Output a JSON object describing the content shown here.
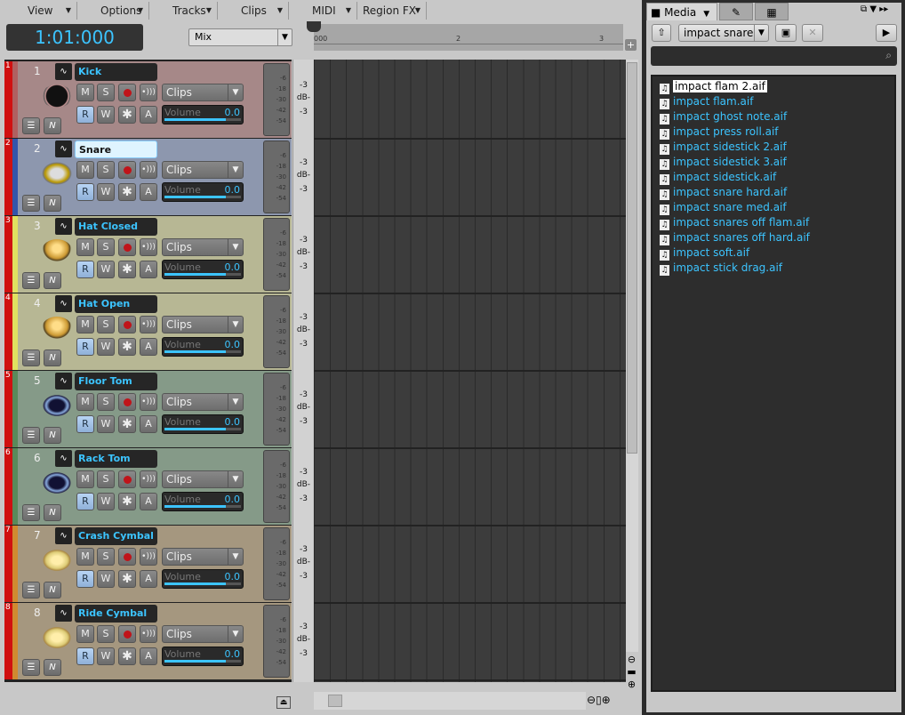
{
  "menu": [
    {
      "label": "View"
    },
    {
      "label": "Options"
    },
    {
      "label": "Tracks"
    },
    {
      "label": "Clips"
    },
    {
      "label": "MIDI"
    },
    {
      "label": "Region FX"
    }
  ],
  "transport": {
    "time": "1:01:000",
    "view_select": "Mix"
  },
  "ruler": {
    "labels": [
      "000",
      "2",
      "3"
    ]
  },
  "track_common": {
    "mute": "M",
    "solo": "S",
    "read": "R",
    "write": "W",
    "fx": "✱",
    "arm": "A",
    "clips": "Clips",
    "volume_label": "Volume",
    "volume_value": "0.0",
    "volume_level_percent": 80,
    "meter_scale": [
      "-6",
      "-18",
      "-30",
      "-42",
      "-54"
    ],
    "db_label": "dB-",
    "db_top": "-3",
    "db_bottom": "-3"
  },
  "tracks": [
    {
      "num": "1",
      "name": "Kick",
      "bg": "#a68888",
      "strip": "#b06060",
      "inst": "kick"
    },
    {
      "num": "2",
      "name": "Snare",
      "bg": "#8d97ae",
      "strip": "#3355aa",
      "inst": "snare",
      "selected": true
    },
    {
      "num": "3",
      "name": "Hat Closed",
      "bg": "#b7b794",
      "strip": "#e0e060",
      "inst": "hat"
    },
    {
      "num": "4",
      "name": "Hat Open",
      "bg": "#b7b794",
      "strip": "#e0e060",
      "inst": "hat"
    },
    {
      "num": "5",
      "name": "Floor Tom",
      "bg": "#859a88",
      "strip": "#5a8a5a",
      "inst": "tom"
    },
    {
      "num": "6",
      "name": "Rack Tom",
      "bg": "#859a88",
      "strip": "#5a8a5a",
      "inst": "tom"
    },
    {
      "num": "7",
      "name": "Crash Cymbal",
      "bg": "#a5977f",
      "strip": "#d08a30",
      "inst": "cymbal"
    },
    {
      "num": "8",
      "name": "Ride Cymbal",
      "bg": "#a5977f",
      "strip": "#d08a30",
      "inst": "cymbal"
    }
  ],
  "media": {
    "tab": "Media",
    "folder": "impact snare",
    "search_placeholder": "",
    "files": [
      "impact flam 2.aif",
      "impact flam.aif",
      "impact ghost note.aif",
      "impact press roll.aif",
      "impact sidestick 2.aif",
      "impact sidestick 3.aif",
      "impact sidestick.aif",
      "impact snare hard.aif",
      "impact snare med.aif",
      "impact snares off flam.aif",
      "impact snares off hard.aif",
      "impact soft.aif",
      "impact stick drag.aif"
    ],
    "selected_index": 0
  },
  "colors": {
    "accent": "#3cc4ff",
    "record": "#c0141a"
  }
}
